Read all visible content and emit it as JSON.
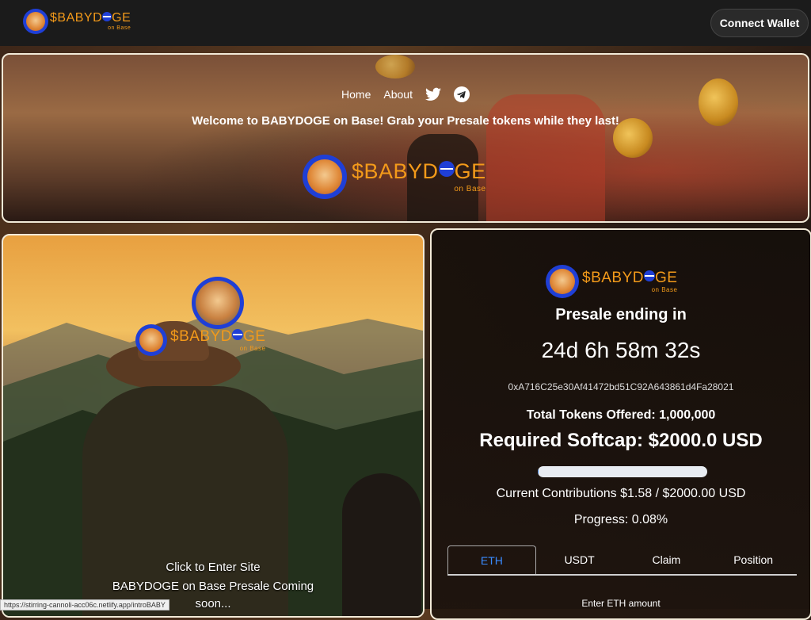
{
  "header": {
    "logo_text": "$BABYD",
    "logo_text_end": "GE",
    "logo_sub": "on Base",
    "connect_label": "Connect Wallet"
  },
  "hero": {
    "nav": {
      "home": "Home",
      "about": "About",
      "twitter_icon": "twitter-icon",
      "telegram_icon": "telegram-icon"
    },
    "welcome": "Welcome to BABYDOGE on Base! Grab your Presale tokens while they last!"
  },
  "left": {
    "click_text": "Click to Enter Site",
    "coming_line1": "BABYDOGE on Base Presale Coming",
    "coming_line2": "soon..."
  },
  "presale": {
    "ending_label": "Presale ending in",
    "countdown": "24d 6h 58m 32s",
    "contract": "0xA716C25e30Af41472bd51C92A643861d4Fa28021",
    "tokens_offered": "Total Tokens Offered: 1,000,000",
    "softcap": "Required Softcap: $2000.0 USD",
    "progress_fraction": 0.0008,
    "contributions": "Current Contributions $1.58 / $2000.00 USD",
    "progress_text": "Progress: 0.08%",
    "tabs": [
      "ETH",
      "USDT",
      "Claim",
      "Position"
    ],
    "active_tab": "ETH",
    "enter_amount": "Enter ETH amount"
  },
  "status_url": "https://stirring-cannoli-acc06c.netlify.app/introBABY",
  "colors": {
    "brand_orange": "#f39a1a",
    "brand_blue": "#1f3fd6",
    "tab_active": "#3a8bff"
  }
}
